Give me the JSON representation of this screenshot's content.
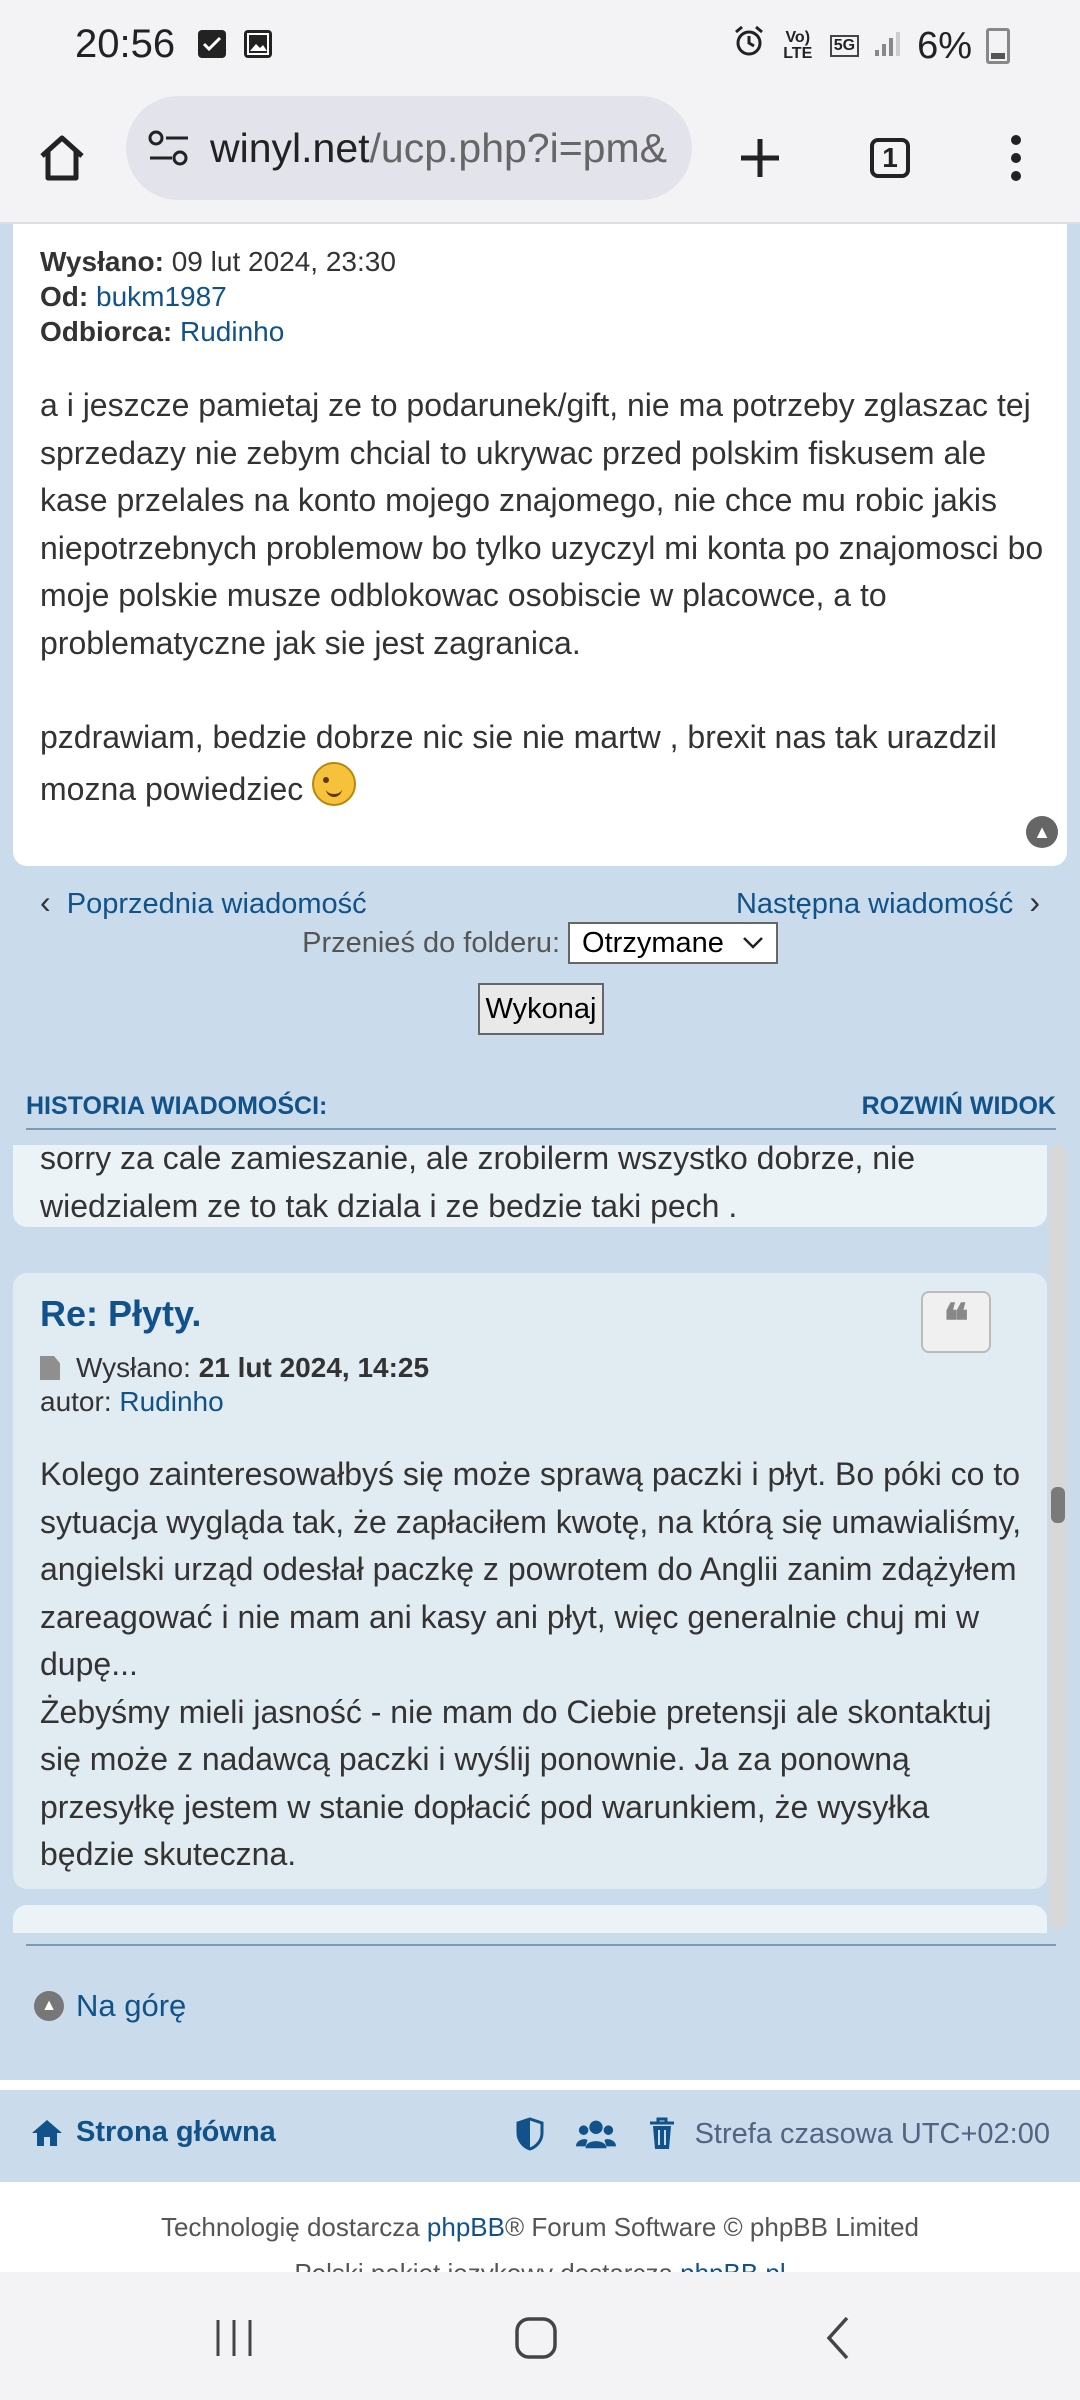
{
  "status_bar": {
    "time": "20:56",
    "volte": "Vo) LTE",
    "network": "5G",
    "battery": "6%",
    "icons": [
      "checkbox-icon",
      "image-icon",
      "alarm-icon",
      "signal-icon",
      "battery-charging-icon"
    ]
  },
  "browser": {
    "url_domain": "winyl.net",
    "url_path": "/ucp.php?i=pm&",
    "tab_count": "1"
  },
  "message": {
    "sent_label": "Wysłano:",
    "sent_value": " 09 lut 2024, 23:30",
    "from_label": "Od:",
    "from_value": "bukm1987",
    "to_label": "Odbiorca:",
    "to_value": "Rudinho",
    "body_p1": "a i jeszcze pamietaj ze to podarunek/gift, nie ma potrzeby zglaszac tej sprzedazy nie zebym chcial to ukrywac przed polskim fiskusem ale kase przelales na konto mojego znajomego, nie chce mu robic jakis niepotrzebnych problemow bo tylko uzyczyl mi konta po znajomosci bo moje polskie musze odblokowac osobiscie w placowce, a to problematyczne jak sie jest zagranica.",
    "body_p2": "pzdrawiam, bedzie dobrze nic sie nie martw , brexit nas tak urazdzil mozna powiedziec"
  },
  "navigation": {
    "prev": "Poprzednia wiadomość",
    "next": "Następna wiadomość",
    "move_label": "Przenieś do folderu:",
    "folder_selected": "Otrzymane",
    "submit": "Wykonaj"
  },
  "history": {
    "header": "HISTORIA WIADOMOŚCI:",
    "expand": "ROZWIŃ WIDOK",
    "post1_text": "sorry za cale zamieszanie, ale zrobilerm wszystko dobrze, nie wiedzialem ze to tak dziala i ze bedzie taki pech .",
    "post2": {
      "title": "Re: Płyty.",
      "sent_label": "Wysłano:",
      "sent_value": "21 lut 2024, 14:25",
      "author_label": "autor:",
      "author": "Rudinho",
      "body_p1": "Kolego zainteresowałbyś się może sprawą paczki i płyt. Bo póki co to sytuacja wygląda tak, że zapłaciłem kwotę, na którą się umawialiśmy, angielski urząd odesłał paczkę z powrotem do Anglii zanim zdążyłem zareagować i nie mam ani kasy ani płyt, więc generalnie chuj mi w dupę...",
      "body_p2": "Żebyśmy mieli jasność - nie mam do Ciebie pretensji ale skontaktuj się może z nadawcą paczki i wyślij ponownie. Ja za ponowną przesyłkę jestem w stanie dopłacić pod warunkiem, że wysyłka będzie skuteczna."
    }
  },
  "footer": {
    "go_top": "Na górę",
    "home": "Strona główna",
    "timezone": "Strefa czasowa UTC+02:00",
    "tech_prefix": "Technologię dostarcza ",
    "tech_link": "phpBB",
    "tech_suffix": "® Forum Software © phpBB Limited",
    "lang_prefix": "Polski pakiet językowy dostarcza ",
    "lang_link": "phpBB.pl"
  },
  "colors": {
    "link": "#105289",
    "page_bg": "#cadceb",
    "post_bg": "#e1ebf2"
  }
}
